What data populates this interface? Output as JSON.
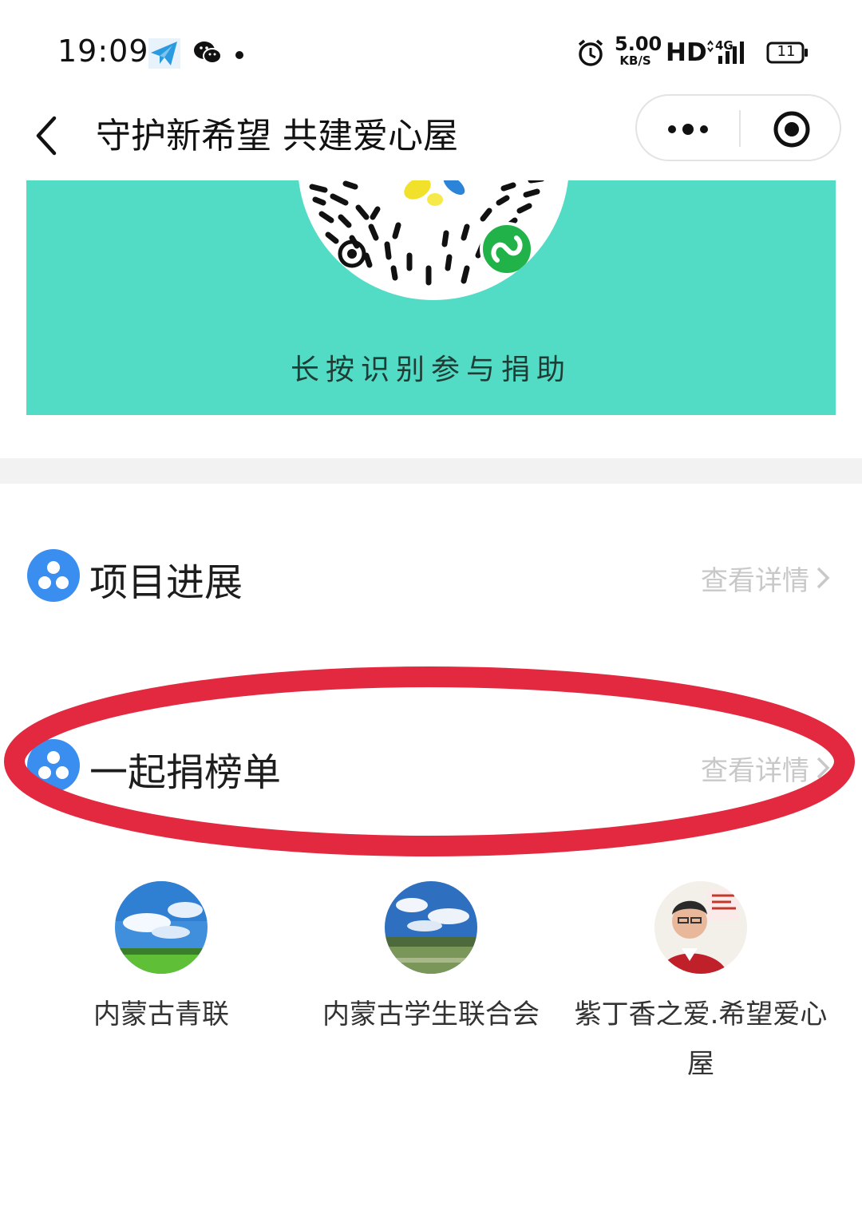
{
  "status_bar": {
    "time": "19:09",
    "speed_value": "5.00",
    "speed_unit": "KB/S",
    "hd": "HD",
    "network": "4G",
    "battery": "11",
    "icons": [
      "telegram-icon",
      "wechat-icon",
      "dot-icon",
      "alarm-icon",
      "signal-icon",
      "battery-icon"
    ]
  },
  "nav": {
    "title": "守护新希望 共建爱心屋",
    "icons": [
      "back-arrow-icon",
      "more-dots-icon",
      "close-target-icon"
    ]
  },
  "banner": {
    "caption": "长按识别参与捐助",
    "background_color": "#52dcc6"
  },
  "sections": {
    "progress": {
      "title": "项目进展",
      "link": "查看详情"
    },
    "ranking": {
      "title": "一起捐榜单",
      "link": "查看详情"
    }
  },
  "donors": [
    {
      "name": "内蒙古青联"
    },
    {
      "name": "内蒙古学生联合会"
    },
    {
      "name": "紫丁香之爱.希望爱心屋"
    }
  ],
  "colors": {
    "accent_blue": "#3a8ef0",
    "highlight_red": "#e3293f",
    "link_gray": "#c8c8c8"
  }
}
